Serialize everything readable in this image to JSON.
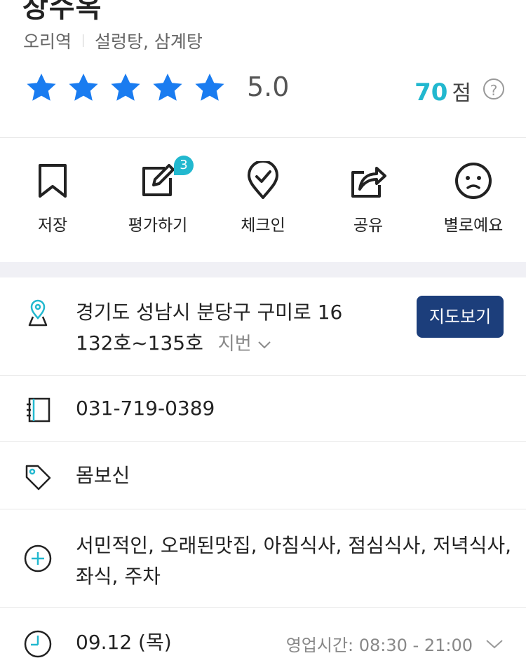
{
  "header": {
    "title": "장수옥",
    "station": "오리역",
    "categories": "설렁탕, 삼계탕",
    "rating": "5.0",
    "rating_stars": 5,
    "score_num": "70",
    "score_unit": "점",
    "help": "?"
  },
  "actions": [
    {
      "label": "저장",
      "icon": "bookmark-icon"
    },
    {
      "label": "평가하기",
      "icon": "edit-icon",
      "badge": "3"
    },
    {
      "label": "체크인",
      "icon": "location-check-icon"
    },
    {
      "label": "공유",
      "icon": "share-icon"
    },
    {
      "label": "별로예요",
      "icon": "frown-face-icon"
    }
  ],
  "info": {
    "address_line1": "경기도 성남시 분당구 구미로 16",
    "address_line2": "132호~135호",
    "jibun_label": "지번",
    "map_button": "지도보기",
    "phone": "031-719-0389",
    "tags": "몸보신",
    "features_line1": "서민적인, 오래된맛집, 아침식사, 점심식사, 저녁식사,",
    "features_line2": "좌식, 주차",
    "date": "09.12 (목)",
    "hours": "영업시간: 08:30 - 21:00"
  },
  "colors": {
    "star": "#1a7cf0",
    "accent": "#22b8cf",
    "map_button": "#1c3e7b"
  }
}
